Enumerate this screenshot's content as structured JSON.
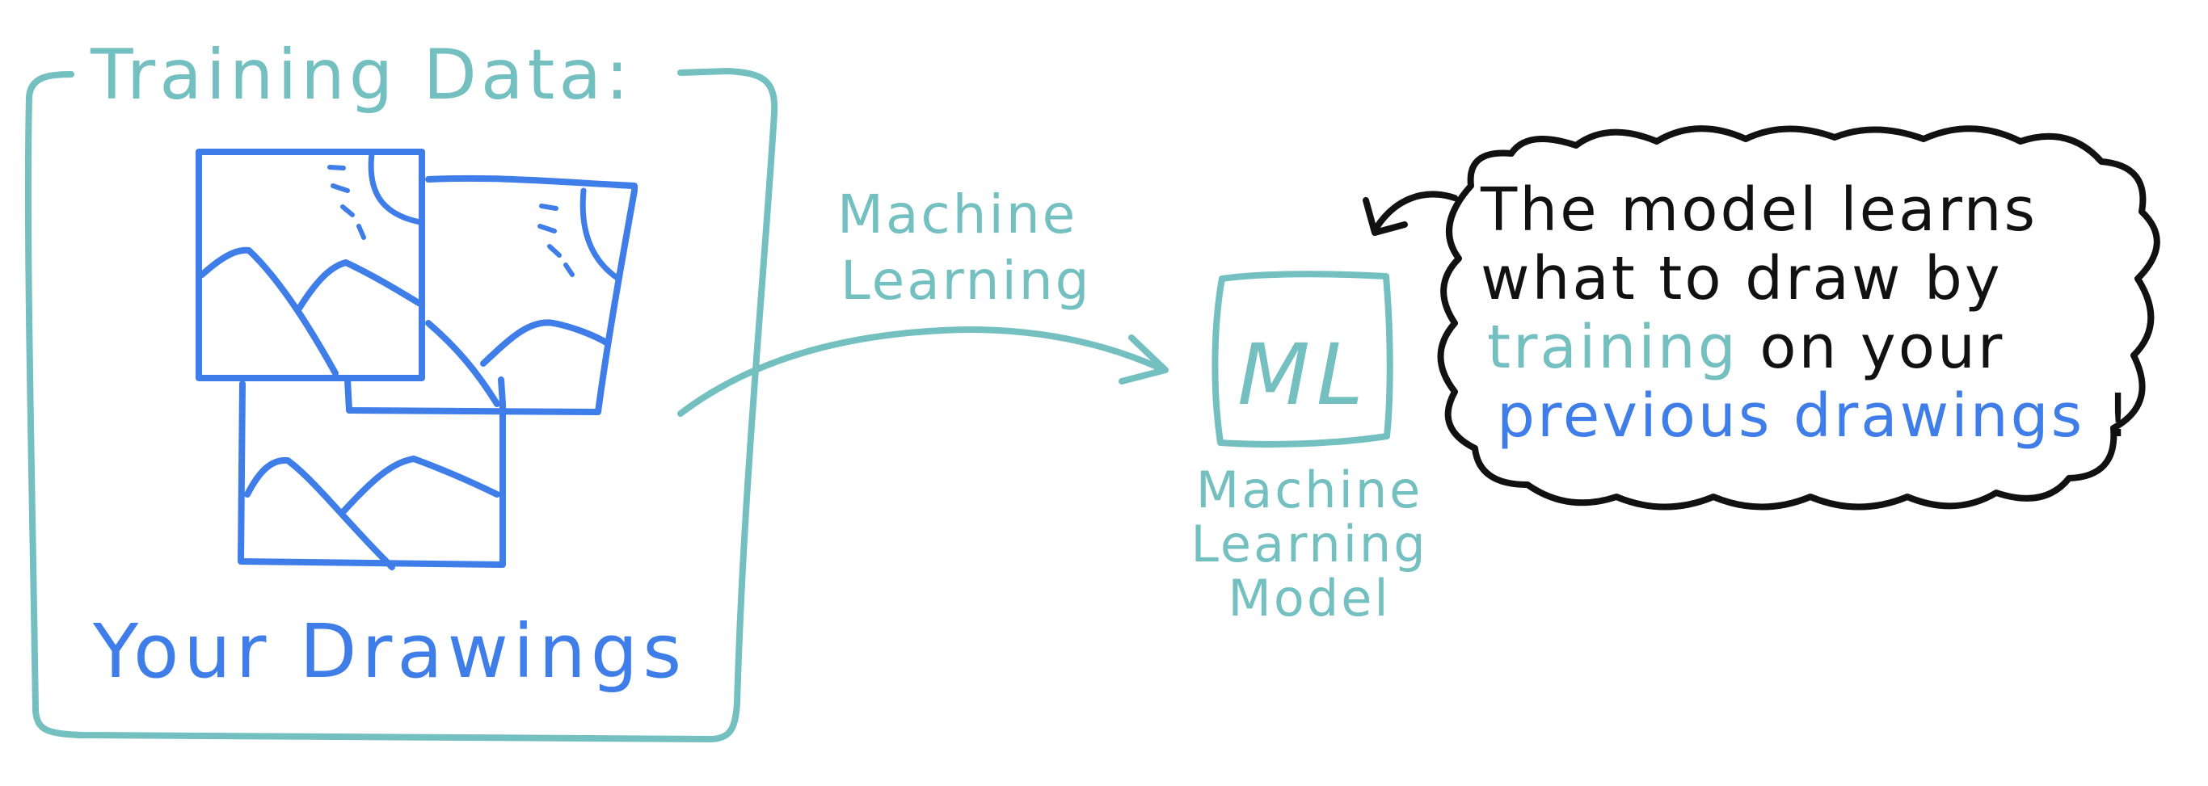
{
  "colors": {
    "teal": "#74BFC0",
    "blue": "#3F7DE8",
    "black": "#111111",
    "background": "#FFFFFF"
  },
  "training_data": {
    "title": "Training Data:",
    "caption": "Your Drawings",
    "thumbnails": [
      "landscape-sketch",
      "landscape-sketch",
      "landscape-sketch"
    ]
  },
  "process": {
    "label_line1": "Machine",
    "label_line2": "Learning",
    "arrow_icon": "curved-arrow-right"
  },
  "model": {
    "box_text": "ML",
    "caption_line1": "Machine",
    "caption_line2": "Learning",
    "caption_line3": "Model"
  },
  "bubble": {
    "line1": "The model learns",
    "line2": "what to draw by",
    "line3_highlight": "training",
    "line3_rest": "on your",
    "line4_highlight": "previous drawings",
    "line4_end": "!",
    "pointer_icon": "arrow-left-icon"
  }
}
